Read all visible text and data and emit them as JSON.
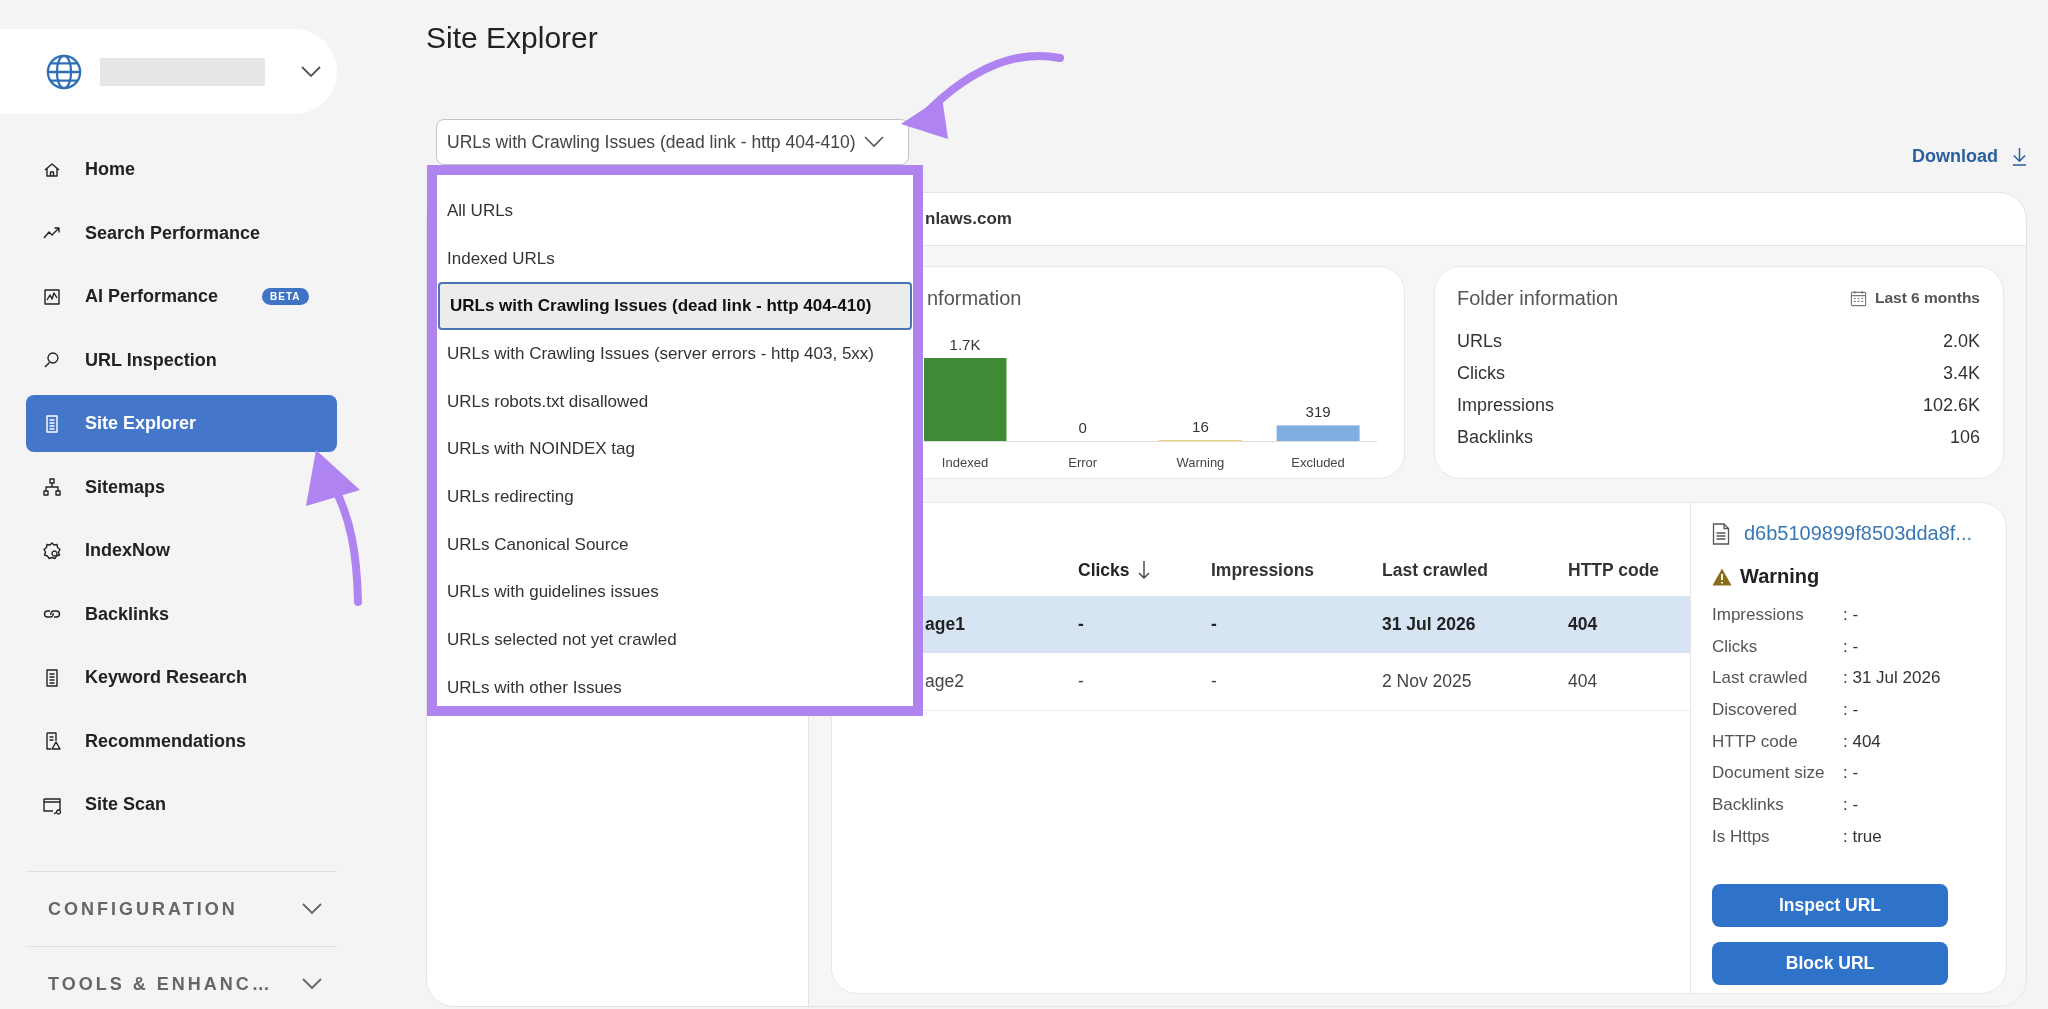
{
  "page_title": "Site Explorer",
  "sidebar": {
    "items": [
      {
        "label": "Home",
        "selected": false
      },
      {
        "label": "Search Performance",
        "selected": false
      },
      {
        "label": "AI Performance",
        "selected": false,
        "badge": "BETA"
      },
      {
        "label": "URL Inspection",
        "selected": false
      },
      {
        "label": "Site Explorer",
        "selected": true
      },
      {
        "label": "Sitemaps",
        "selected": false
      },
      {
        "label": "IndexNow",
        "selected": false
      },
      {
        "label": "Backlinks",
        "selected": false
      },
      {
        "label": "Keyword Research",
        "selected": false
      },
      {
        "label": "Recommendations",
        "selected": false
      },
      {
        "label": "Site Scan",
        "selected": false
      }
    ],
    "sections": [
      {
        "label": "CONFIGURATION",
        "expanded": false
      },
      {
        "label": "TOOLS & ENHANC…",
        "expanded": false
      }
    ]
  },
  "filter": {
    "value": "URLs with Crawling Issues (dead link - http 404-410)",
    "expanded": true,
    "options": [
      {
        "label": "All URLs",
        "selected": false
      },
      {
        "label": "Indexed URLs",
        "selected": false
      },
      {
        "label": "URLs with Crawling Issues (dead link - http 404-410)",
        "selected": true
      },
      {
        "label": "URLs with Crawling Issues (server errors - http 403, 5xx)",
        "selected": false
      },
      {
        "label": "URLs robots.txt disallowed",
        "selected": false
      },
      {
        "label": "URLs with NOINDEX tag",
        "selected": false
      },
      {
        "label": "URLs redirecting",
        "selected": false
      },
      {
        "label": "URLs Canonical Source",
        "selected": false
      },
      {
        "label": "URLs with guidelines issues",
        "selected": false
      },
      {
        "label": "URLs selected not yet crawled",
        "selected": false
      },
      {
        "label": "URLs with other Issues",
        "selected": false
      }
    ]
  },
  "download": "Download",
  "site_header": "nlaws.com",
  "info_card": {
    "title": "nformation",
    "chart_data": {
      "type": "bar",
      "categories": [
        "Indexed",
        "Error",
        "Warning",
        "Excluded"
      ],
      "value_labels": [
        "1.7K",
        "0",
        "16",
        "319"
      ],
      "values": [
        1700,
        0,
        16,
        319
      ],
      "colors": [
        "#3f8a34",
        "#d9534f",
        "#e8c95a",
        "#7eaee2"
      ]
    }
  },
  "folder_card": {
    "title": "Folder information",
    "period": "Last 6 months",
    "rows": [
      {
        "label": "URLs",
        "value": "2.0K"
      },
      {
        "label": "Clicks",
        "value": "3.4K"
      },
      {
        "label": "Impressions",
        "value": "102.6K"
      },
      {
        "label": "Backlinks",
        "value": "106"
      }
    ]
  },
  "table": {
    "columns": [
      {
        "label": "Clicks",
        "sorted": true
      },
      {
        "label": "Impressions",
        "sorted": false
      },
      {
        "label": "Last crawled",
        "sorted": false
      },
      {
        "label": "HTTP code",
        "sorted": false
      }
    ],
    "rows": [
      {
        "page": "age1",
        "cells": [
          "-",
          "-",
          "31 Jul 2026",
          "404"
        ],
        "selected": true
      },
      {
        "page": "age2",
        "cells": [
          "-",
          "-",
          "2 Nov 2025",
          "404"
        ],
        "selected": false
      }
    ]
  },
  "detail": {
    "link": "d6b5109899f8503dda8f...",
    "status": "Warning",
    "rows": [
      {
        "label": "Impressions",
        "value": ": -"
      },
      {
        "label": "Clicks",
        "value": ": -"
      },
      {
        "label": "Last crawled",
        "value": ": 31 Jul 2026"
      },
      {
        "label": "Discovered",
        "value": ": -"
      },
      {
        "label": "HTTP code",
        "value": ": 404"
      },
      {
        "label": "Document size",
        "value": ": -"
      },
      {
        "label": "Backlinks",
        "value": ": -"
      },
      {
        "label": "Is Https",
        "value": ": true"
      }
    ],
    "buttons": [
      "Inspect URL",
      "Block URL"
    ]
  }
}
